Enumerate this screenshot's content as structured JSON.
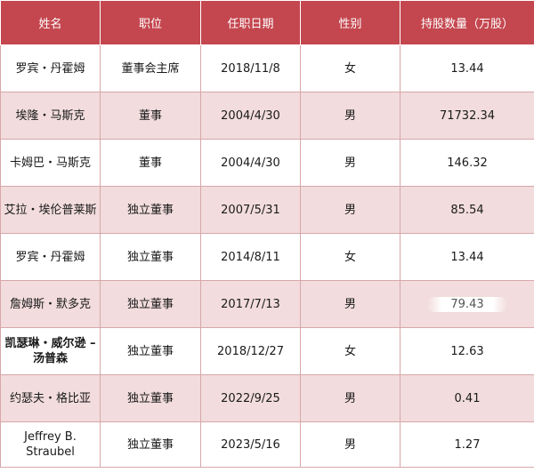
{
  "table": {
    "headers": [
      "姓名",
      "职位",
      "任职日期",
      "性别",
      "持股数量（万股）"
    ],
    "rows": [
      {
        "name": "罗宾・丹霍姆",
        "position": "董事会主席",
        "date": "2018/11/8",
        "gender": "女",
        "shares": "13.44"
      },
      {
        "name": "埃隆・马斯克",
        "position": "董事",
        "date": "2004/4/30",
        "gender": "男",
        "shares": "71732.34"
      },
      {
        "name": "卡姆巴・马斯克",
        "position": "董事",
        "date": "2004/4/30",
        "gender": "男",
        "shares": "146.32"
      },
      {
        "name": "艾拉・埃伦普莱斯",
        "position": "独立董事",
        "date": "2007/5/31",
        "gender": "男",
        "shares": "85.54"
      },
      {
        "name": "罗宾・丹霍姆",
        "position": "独立董事",
        "date": "2014/8/11",
        "gender": "女",
        "shares": "13.44"
      },
      {
        "name": "詹姆斯・默多克",
        "position": "独立董事",
        "date": "2017/7/13",
        "gender": "男",
        "shares": "79.43"
      },
      {
        "name": "凯瑟琳・威尔逊 – 汤普森",
        "position": "独立董事",
        "date": "2018/12/27",
        "gender": "女",
        "shares": "12.63"
      },
      {
        "name": "约瑟夫・格比亚",
        "position": "独立董事",
        "date": "2022/9/25",
        "gender": "男",
        "shares": "0.41"
      },
      {
        "name": "Jeffrey B. Straubel",
        "position": "独立董事",
        "date": "2023/5/16",
        "gender": "男",
        "shares": "1.27"
      }
    ]
  },
  "colors": {
    "header_bg": "#c4474f",
    "alt_row_bg": "#f2dcdd",
    "border": "#d7a7aa"
  }
}
